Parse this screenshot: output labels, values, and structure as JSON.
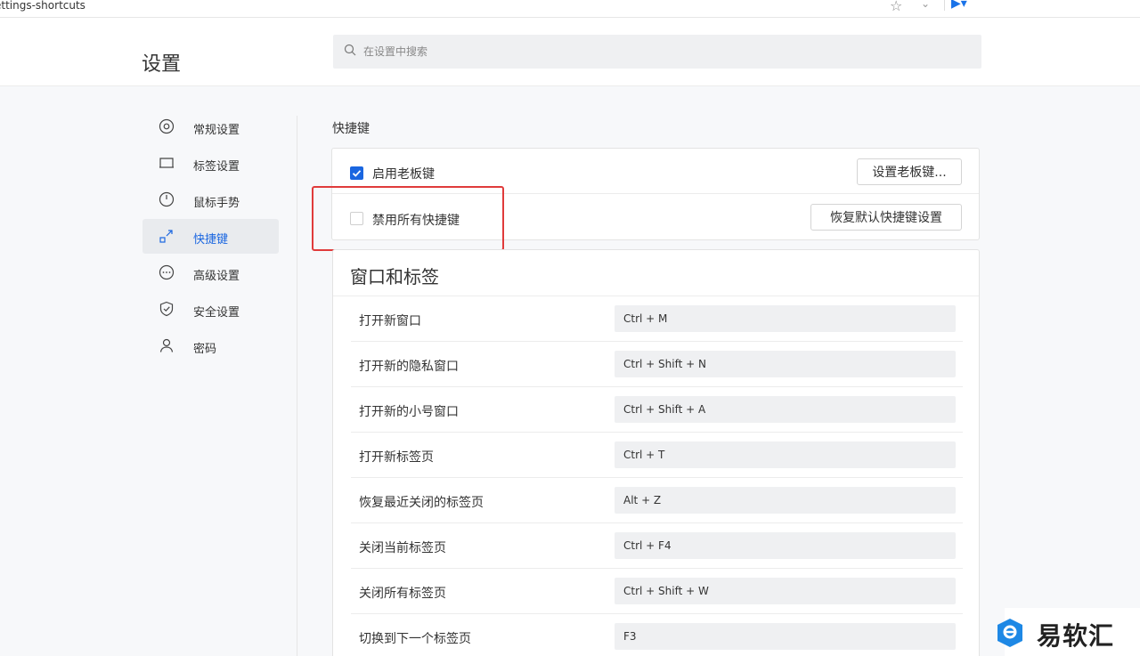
{
  "addressbar": {
    "url_fragment": "ettings-shortcuts"
  },
  "header": {
    "title": "设置",
    "search_placeholder": "在设置中搜索"
  },
  "sidebar": {
    "items": [
      {
        "label": "常规设置",
        "icon": "general-settings-icon",
        "active": false
      },
      {
        "label": "标签设置",
        "icon": "tab-icon",
        "active": false
      },
      {
        "label": "鼠标手势",
        "icon": "mouse-icon",
        "active": false
      },
      {
        "label": "快捷键",
        "icon": "shortcut-arrow-icon",
        "active": true
      },
      {
        "label": "高级设置",
        "icon": "more-dots-icon",
        "active": false
      },
      {
        "label": "安全设置",
        "icon": "shield-icon",
        "active": false
      },
      {
        "label": "密码",
        "icon": "user-icon",
        "active": false
      }
    ]
  },
  "shortcuts": {
    "section_title": "快捷键",
    "boss_key": {
      "label": "启用老板键",
      "checked": true,
      "button": "设置老板键..."
    },
    "disable_all": {
      "label": "禁用所有快捷键",
      "checked": false,
      "button": "恢复默认快捷键设置"
    }
  },
  "window_tabs": {
    "title": "窗口和标签",
    "rows": [
      {
        "label": "打开新窗口",
        "key": "Ctrl + M"
      },
      {
        "label": "打开新的隐私窗口",
        "key": "Ctrl + Shift + N"
      },
      {
        "label": "打开新的小号窗口",
        "key": "Ctrl + Shift + A"
      },
      {
        "label": "打开新标签页",
        "key": "Ctrl + T"
      },
      {
        "label": "恢复最近关闭的标签页",
        "key": "Alt + Z"
      },
      {
        "label": "关闭当前标签页",
        "key": "Ctrl + F4"
      },
      {
        "label": "关闭所有标签页",
        "key": "Ctrl + Shift + W"
      },
      {
        "label": "切换到下一个标签页",
        "key": "F3"
      }
    ]
  },
  "watermark": {
    "text": "易软汇"
  },
  "colors": {
    "accent": "#1a66e0",
    "highlight": "#e03b3b"
  }
}
